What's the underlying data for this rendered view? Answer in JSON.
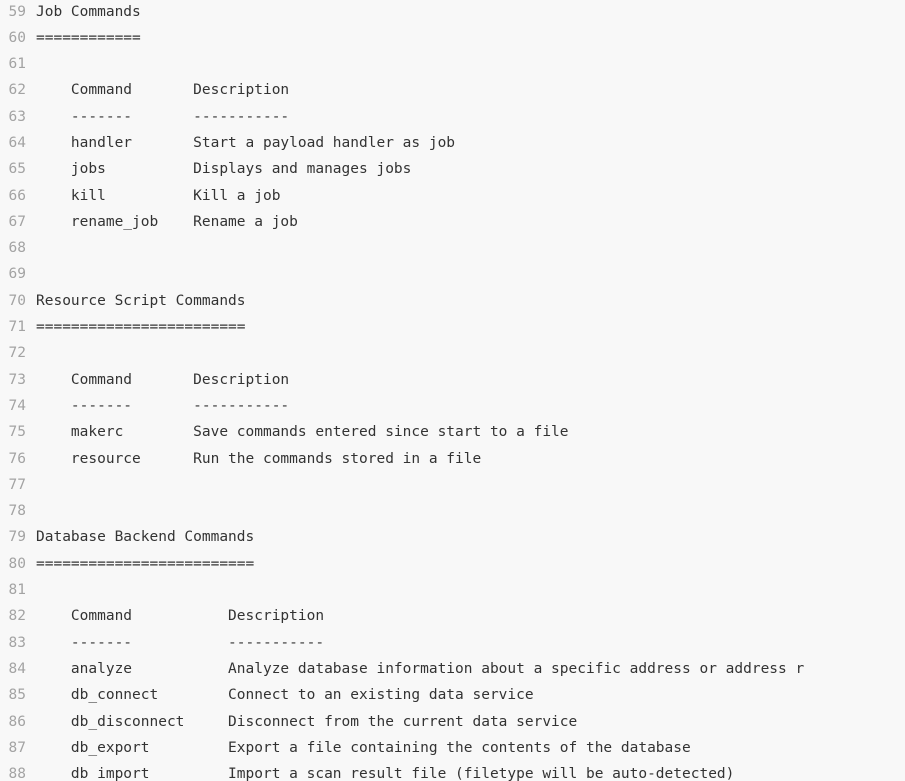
{
  "lines": [
    {
      "n": "59",
      "t": "Job Commands"
    },
    {
      "n": "60",
      "t": "============"
    },
    {
      "n": "61",
      "t": ""
    },
    {
      "n": "62",
      "t": "    Command       Description"
    },
    {
      "n": "63",
      "t": "    -------       -----------"
    },
    {
      "n": "64",
      "t": "    handler       Start a payload handler as job"
    },
    {
      "n": "65",
      "t": "    jobs          Displays and manages jobs"
    },
    {
      "n": "66",
      "t": "    kill          Kill a job"
    },
    {
      "n": "67",
      "t": "    rename_job    Rename a job"
    },
    {
      "n": "68",
      "t": ""
    },
    {
      "n": "69",
      "t": ""
    },
    {
      "n": "70",
      "t": "Resource Script Commands"
    },
    {
      "n": "71",
      "t": "========================"
    },
    {
      "n": "72",
      "t": ""
    },
    {
      "n": "73",
      "t": "    Command       Description"
    },
    {
      "n": "74",
      "t": "    -------       -----------"
    },
    {
      "n": "75",
      "t": "    makerc        Save commands entered since start to a file"
    },
    {
      "n": "76",
      "t": "    resource      Run the commands stored in a file"
    },
    {
      "n": "77",
      "t": ""
    },
    {
      "n": "78",
      "t": ""
    },
    {
      "n": "79",
      "t": "Database Backend Commands"
    },
    {
      "n": "80",
      "t": "========================="
    },
    {
      "n": "81",
      "t": ""
    },
    {
      "n": "82",
      "t": "    Command           Description"
    },
    {
      "n": "83",
      "t": "    -------           -----------"
    },
    {
      "n": "84",
      "t": "    analyze           Analyze database information about a specific address or address r"
    },
    {
      "n": "85",
      "t": "    db_connect        Connect to an existing data service"
    },
    {
      "n": "86",
      "t": "    db_disconnect     Disconnect from the current data service"
    },
    {
      "n": "87",
      "t": "    db_export         Export a file containing the contents of the database"
    },
    {
      "n": "88",
      "t": "    db_import         Import a scan result file (filetype will be auto-detected)"
    }
  ]
}
